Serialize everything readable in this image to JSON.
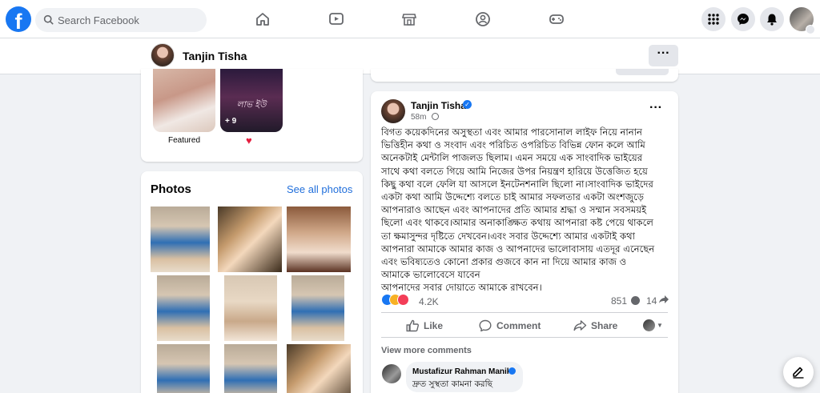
{
  "nav": {
    "search_placeholder": "Search Facebook"
  },
  "profile_bar": {
    "name": "Tanjin Tisha",
    "more": "···"
  },
  "featured": {
    "label": "Featured",
    "story_text": "লাভ ইউ",
    "badge": "+ 9",
    "heart": "♥"
  },
  "photos": {
    "title": "Photos",
    "see_all": "See all photos"
  },
  "post": {
    "author": "Tanjin Tisha",
    "verified_mark": "✓",
    "time": "58m",
    "more": "···",
    "text": "বিগত কয়েকদিনের অসুস্থতা এবং আমার পারসোনাল লাইফ নিয়ে নানান\nভিত্তিহীন কথা ও সংবাদ এবং পরিচিত ওপরিচিত বিভিন্ন ফোন কলে আমি\nঅনেকটাই মেন্টালি পাজলড ছিলাম। এমন সময়ে এক সাংবাদিক ভাইয়ের\nসাথে কথা বলতে গিয়ে আমি নিজের উপর নিয়ন্ত্রণ হারিয়ে উত্তেজিত হয়ে\nকিছু কথা বলে ফেলি যা আসলে ইনটেনশনালি ছিলো না।সাংবাদিক ভাইদের\nএকটা কথা আমি উদ্দেশ্যে বলতে চাই আমার সফলতার একটা অংশজুড়ে\nআপনারাও আছেন এবং আপনাদের প্রতি আমার শ্রদ্ধা ও সম্মান সবসময়ই\nছিলো এবং থাকবে।আমার অনাকাঙ্ক্ষিত কথায় আপনারা কষ্ট পেয়ে থাকলে\nতা ক্ষমাসুন্দর দৃষ্টিতে দেখবেন।এবং সবার উদ্দেশ্যে আমার একটাই কথা\nআপনারা আমাকে আমার কাজ ও আপনাদের ভালোবাসায় এতদূর এনেছেন\nএবং ভবিষ্যতেও কোনো প্রকার গুজবে কান না দিয়ে আমার কাজ ও\nআমাকে ভালোবেসে যাবেন\nআপনাদের সবার দোয়াতে আমাকে রাখবেন।",
    "reaction_count": "4.2K",
    "comment_count": "851",
    "share_count": "14",
    "actions": {
      "like": "Like",
      "comment": "Comment",
      "share": "Share"
    },
    "view_more_comments": "View more comments",
    "comment": {
      "author": "Mustafizur Rahman Manik",
      "text": "দ্রুত সুস্থতা কামনা করছি"
    }
  },
  "colors": {
    "brand": "#1877f2",
    "link": "#216fdb",
    "background": "#f0f2f5",
    "love": "#e41e3f"
  },
  "icons": [
    "facebook-logo-icon",
    "search-icon",
    "home-icon",
    "video-icon",
    "marketplace-icon",
    "groups-icon",
    "gaming-icon",
    "menu-grid-icon",
    "messenger-icon",
    "bell-icon",
    "compose-icon"
  ]
}
